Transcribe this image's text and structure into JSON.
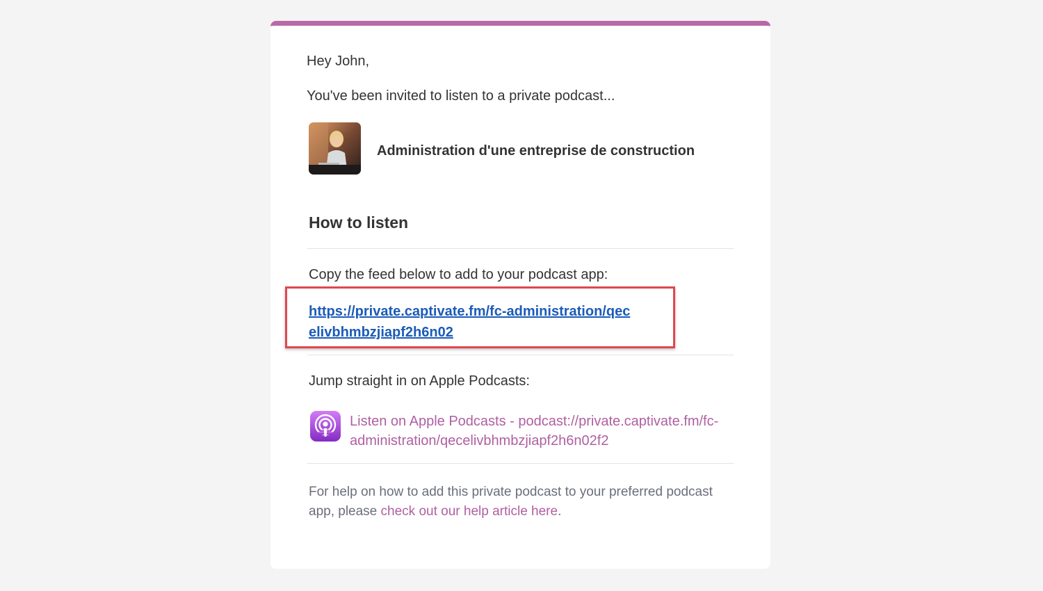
{
  "email": {
    "greeting": "Hey John,",
    "intro": "You've been invited to listen to a private podcast...",
    "podcast_title": "Administration d'une entreprise de construction",
    "how_to_listen_heading": "How to listen",
    "copy_feed_text": "Copy the feed below to add to your podcast app:",
    "feed_url": "https://private.captivate.fm/fc-administration/qecelivbhmbzjiapf2h6n02",
    "jump_text": "Jump straight in on Apple Podcasts:",
    "apple_link": "Listen on Apple Podcasts - podcast://private.captivate.fm/fc-administration/qecelivbhmbzjiapf2h6n02f2",
    "help_prefix": "For help on how to add this private podcast to your preferred podcast app, please ",
    "help_link": "check out our help article here",
    "help_suffix": "."
  },
  "icons": {
    "cover": "podcast-cover-image",
    "apple": "apple-podcasts-icon"
  },
  "colors": {
    "accent": "#b86aa8",
    "link_purple": "#b05fa2",
    "feed_link_blue": "#1a5bb8",
    "highlight_red": "#e0474c",
    "page_background": "#f4f4f4"
  }
}
